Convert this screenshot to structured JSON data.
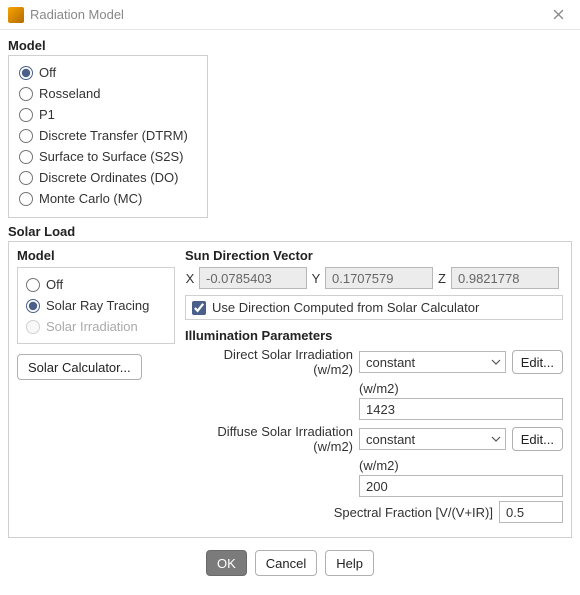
{
  "window": {
    "title": "Radiation Model"
  },
  "model": {
    "heading": "Model",
    "options": {
      "off": "Off",
      "rosseland": "Rosseland",
      "p1": "P1",
      "dtrm": "Discrete Transfer (DTRM)",
      "s2s": "Surface to Surface (S2S)",
      "do": "Discrete Ordinates (DO)",
      "mc": "Monte Carlo (MC)"
    }
  },
  "solar": {
    "heading": "Solar Load",
    "model": {
      "heading": "Model",
      "off": "Off",
      "ray": "Solar Ray Tracing",
      "irr": "Solar Irradiation"
    },
    "calc_button": "Solar Calculator...",
    "sun_vec": {
      "heading": "Sun Direction Vector",
      "xlabel": "X",
      "ylabel": "Y",
      "zlabel": "Z",
      "x": "-0.0785403",
      "y": "0.1707579",
      "z": "0.9821778",
      "use_computed": "Use Direction Computed from Solar Calculator"
    },
    "illum": {
      "heading": "Illumination Parameters",
      "direct_label": "Direct Solar Irradiation (w/m2)",
      "direct_mode": "constant",
      "direct_unit": "(w/m2)",
      "direct_value": "1423",
      "diffuse_label": "Diffuse Solar Irradiation (w/m2)",
      "diffuse_mode": "constant",
      "diffuse_unit": "(w/m2)",
      "diffuse_value": "200",
      "spectral_label": "Spectral Fraction [V/(V+IR)]",
      "spectral_value": "0.5",
      "edit": "Edit..."
    }
  },
  "buttons": {
    "ok": "OK",
    "cancel": "Cancel",
    "help": "Help"
  }
}
